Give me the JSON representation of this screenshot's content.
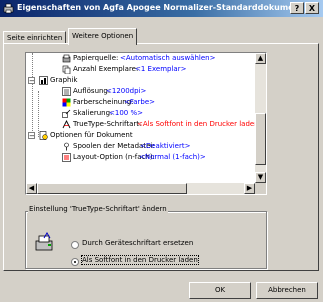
{
  "window": {
    "title": "Eigenschaften von Agfa Apogee Normalizer-Standarddokument",
    "help_label": "?",
    "close_label": "X"
  },
  "tabs": [
    {
      "label": "Seite einrichten",
      "active": false
    },
    {
      "label": "Weitere Optionen",
      "active": true
    }
  ],
  "tree": {
    "items": [
      {
        "label": "Papierquelle:",
        "value": "<Automatisch auswählen>",
        "icon": "paper-source-icon"
      },
      {
        "label": "Anzahl Exemplare:",
        "value": "<1 Exemplar>",
        "icon": "copies-icon"
      },
      {
        "label": "Graphik",
        "value": "",
        "icon": "graphics-icon",
        "expander": "−"
      },
      {
        "label": "Auflösung:",
        "value": "<1200dpi>",
        "icon": "resolution-icon"
      },
      {
        "label": "Farberscheinung:",
        "value": "<Farbe>",
        "icon": "color-icon"
      },
      {
        "label": "Skalierung:",
        "value": "<100 %>",
        "icon": "scaling-icon"
      },
      {
        "label": "TrueType-Schriftart:",
        "value": "<Als Softfont in den Drucker laden>",
        "icon": "font-icon"
      },
      {
        "label": "Optionen für Dokument",
        "value": "",
        "icon": "document-options-icon",
        "expander": "−"
      },
      {
        "label": "Spoolen der Metadatei:",
        "value": "<Deaktiviert>",
        "icon": "spool-icon"
      },
      {
        "label": "Layout-Option (n-fach):",
        "value": "<Normal (1-fach)>",
        "icon": "layout-icon"
      }
    ]
  },
  "group": {
    "title": "Einstellung 'TrueType-Schriftart' ändern",
    "options": [
      {
        "label": "Durch Geräteschriftart ersetzen",
        "selected": false
      },
      {
        "label": "Als Softfont in den Drucker laden",
        "selected": true
      }
    ]
  },
  "buttons": {
    "ok": "OK",
    "cancel": "Abbrechen"
  },
  "colors": {
    "value_text": "#0000ff",
    "selected_value_text": "#ff0000",
    "title_bar_start": "#0a246a"
  }
}
